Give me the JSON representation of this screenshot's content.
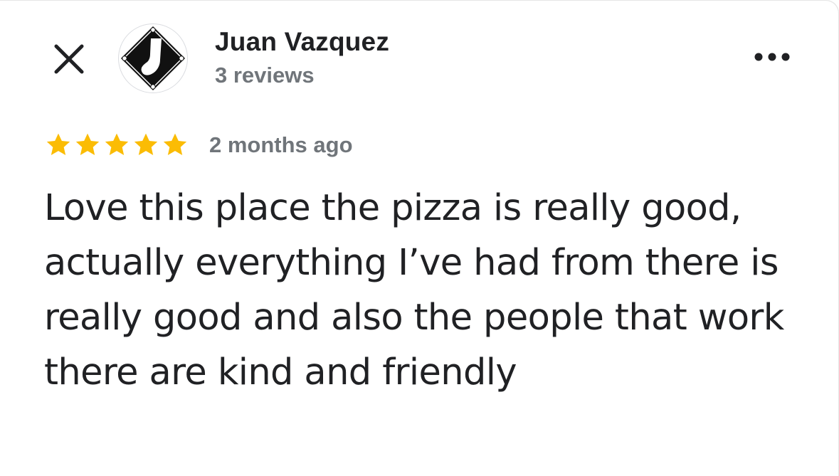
{
  "header": {
    "close_icon": "close-icon",
    "more_icon": "more-horizontal-icon"
  },
  "author": {
    "name": "Juan Vazquez",
    "reviews_count": "3 reviews",
    "avatar_icon": "sock-logo-icon"
  },
  "review": {
    "rating": 5,
    "rating_max": 5,
    "star_color": "#fbbc04",
    "date": "2 months ago",
    "text": "Love this place the pizza is really good, actually everything I’ve had from there is really good and also the people that work there are kind and friendly"
  }
}
